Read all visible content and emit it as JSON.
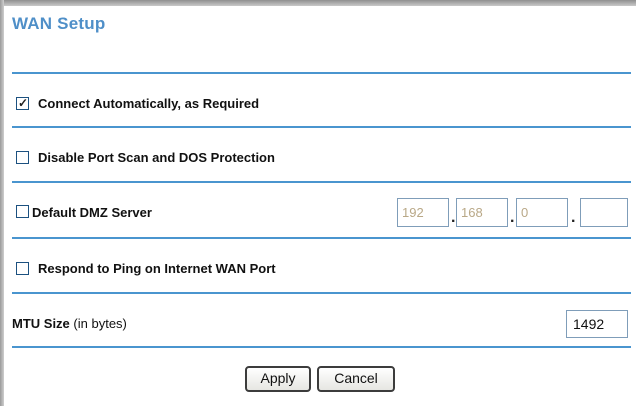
{
  "page": {
    "title": "WAN Setup"
  },
  "options": {
    "connect_auto": {
      "label": "Connect Automatically, as Required",
      "checked": true
    },
    "disable_port_scan": {
      "label": "Disable Port Scan and DOS Protection",
      "checked": false
    },
    "dmz_server": {
      "label": "Default DMZ Server",
      "checked": false,
      "ip": [
        "192",
        "168",
        "0",
        ""
      ]
    },
    "respond_ping": {
      "label": "Respond to Ping on Internet WAN Port",
      "checked": false
    }
  },
  "mtu": {
    "label_bold": "MTU Size",
    "label_suffix": "(in bytes)",
    "value": "1492"
  },
  "buttons": {
    "apply": "Apply",
    "cancel": "Cancel"
  },
  "colors": {
    "title": "#4f8fc8",
    "separator": "#4a95cf"
  },
  "icons": {
    "checkmark": "check-icon"
  }
}
